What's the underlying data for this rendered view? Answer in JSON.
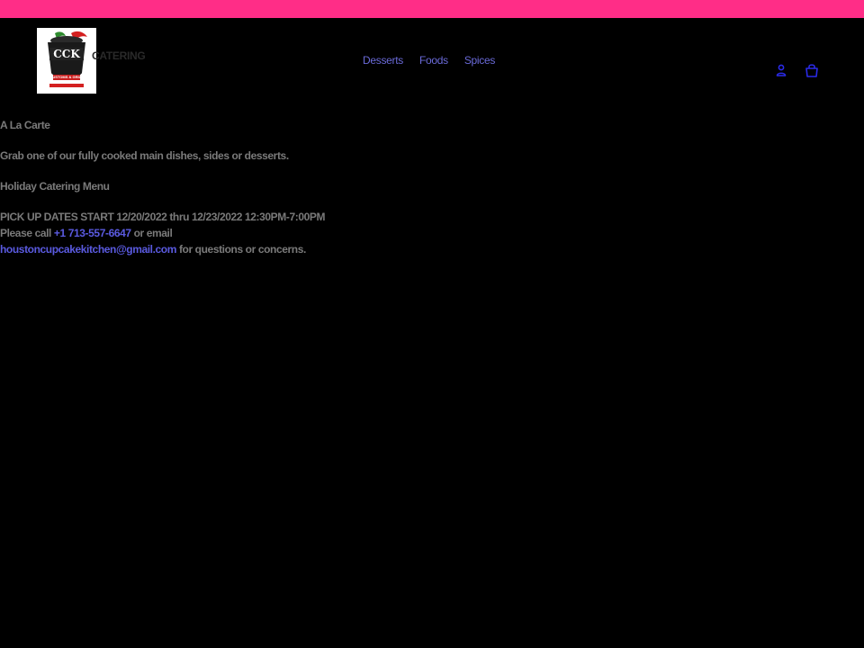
{
  "header": {
    "logo_text": "CCK",
    "logo_tagline": "CUSTOMS & GRILL",
    "site_name": "CATERING",
    "nav": [
      {
        "label": "Desserts"
      },
      {
        "label": "Foods"
      },
      {
        "label": "Spices"
      }
    ],
    "icons": {
      "account": "account-icon",
      "cart": "cart-icon"
    }
  },
  "content": {
    "title": "A La Carte",
    "description": "Grab one of our fully cooked main dishes, sides or desserts.",
    "menu_title": "Holiday Catering Menu",
    "pickup": "PICK UP DATES START 12/20/2022 thru 12/23/2022 12:30PM-7:00PM",
    "call_prefix": "Please call ",
    "phone": "+1 713-557-6647",
    "call_suffix": " or email",
    "email": "houstoncupcakekitchen@gmail.com",
    "email_suffix": " for questions or concerns."
  },
  "colors": {
    "announcement_bar": "#ff2d87",
    "background": "#000000",
    "link": "#5a5ae0",
    "text": "#7a7a7a"
  }
}
